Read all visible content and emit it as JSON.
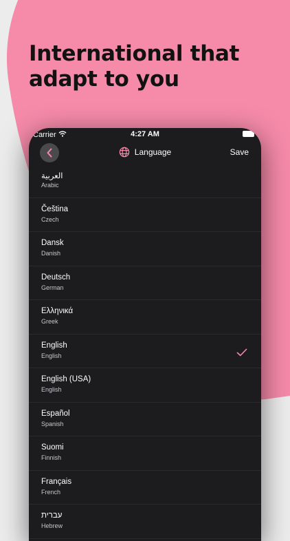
{
  "headline": "International that adapt to you",
  "status_bar": {
    "carrier": "Carrier",
    "time": "4:27 AM"
  },
  "nav": {
    "title": "Language",
    "save_label": "Save"
  },
  "accent_color": "#f58aa9",
  "languages": [
    {
      "native": "العربية",
      "english": "Arabic",
      "selected": false
    },
    {
      "native": "Čeština",
      "english": "Czech",
      "selected": false
    },
    {
      "native": "Dansk",
      "english": "Danish",
      "selected": false
    },
    {
      "native": "Deutsch",
      "english": "German",
      "selected": false
    },
    {
      "native": "Ελληνικά",
      "english": "Greek",
      "selected": false
    },
    {
      "native": "English",
      "english": "English",
      "selected": true
    },
    {
      "native": "English (USA)",
      "english": "English",
      "selected": false
    },
    {
      "native": "Español",
      "english": "Spanish",
      "selected": false
    },
    {
      "native": "Suomi",
      "english": "Finnish",
      "selected": false
    },
    {
      "native": "Français",
      "english": "French",
      "selected": false
    },
    {
      "native": "עברית",
      "english": "Hebrew",
      "selected": false
    }
  ]
}
